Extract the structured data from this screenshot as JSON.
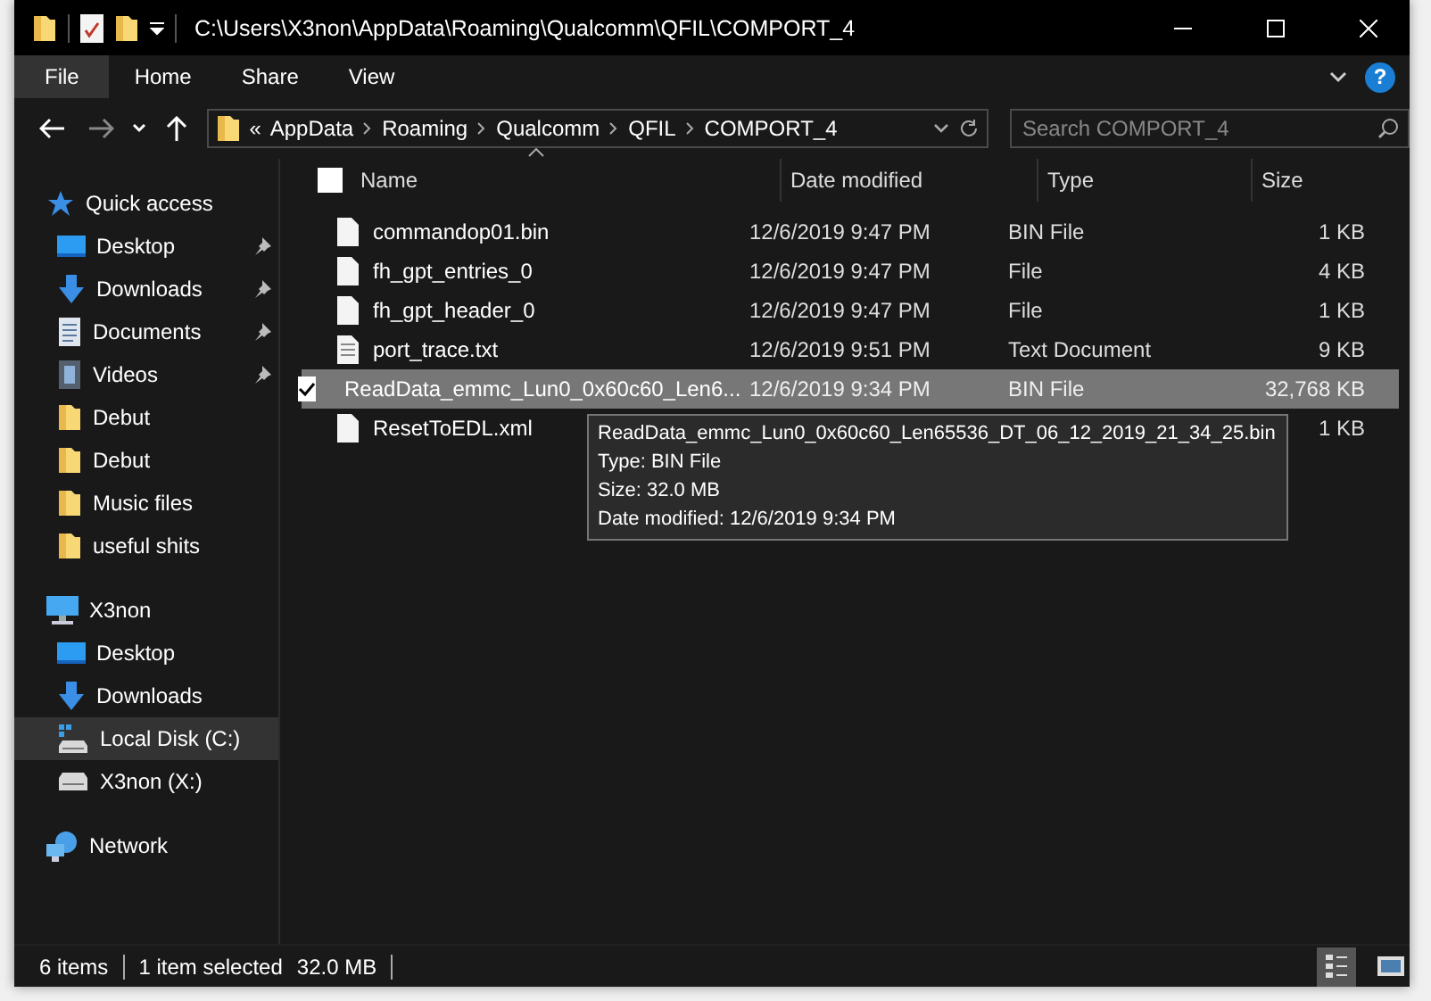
{
  "window": {
    "title": "C:\\Users\\X3non\\AppData\\Roaming\\Qualcomm\\QFIL\\COMPORT_4"
  },
  "ribbon_tabs": [
    {
      "label": "File",
      "selected": true
    },
    {
      "label": "Home",
      "selected": false
    },
    {
      "label": "Share",
      "selected": false
    },
    {
      "label": "View",
      "selected": false
    }
  ],
  "help_button": "?",
  "address": {
    "overflow": "«",
    "crumbs": [
      "AppData",
      "Roaming",
      "Qualcomm",
      "QFIL",
      "COMPORT_4"
    ]
  },
  "search": {
    "placeholder": "Search COMPORT_4"
  },
  "sidebar": {
    "items": [
      {
        "label": "Quick access",
        "kind": "quick",
        "selected": false,
        "children": [
          {
            "label": "Desktop",
            "kind": "desktop",
            "pinned": true,
            "selected": false
          },
          {
            "label": "Downloads",
            "kind": "downloads",
            "pinned": true,
            "selected": false
          },
          {
            "label": "Documents",
            "kind": "documents",
            "pinned": true,
            "selected": false
          },
          {
            "label": "Videos",
            "kind": "videos",
            "pinned": true,
            "selected": false
          },
          {
            "label": "Debut",
            "kind": "folder",
            "pinned": false,
            "selected": false
          },
          {
            "label": "Debut",
            "kind": "folder",
            "pinned": false,
            "selected": false
          },
          {
            "label": "Music files",
            "kind": "folder",
            "pinned": false,
            "selected": false
          },
          {
            "label": "useful shits",
            "kind": "folder",
            "pinned": false,
            "selected": false
          }
        ]
      },
      {
        "label": "X3non",
        "kind": "pc",
        "selected": false,
        "children": [
          {
            "label": "Desktop",
            "kind": "desktop",
            "pinned": false,
            "selected": false
          },
          {
            "label": "Downloads",
            "kind": "downloads",
            "pinned": false,
            "selected": false
          },
          {
            "label": "Local Disk (C:)",
            "kind": "system-disk",
            "pinned": false,
            "selected": true
          },
          {
            "label": "X3non (X:)",
            "kind": "drive",
            "pinned": false,
            "selected": false
          }
        ]
      },
      {
        "label": "Network",
        "kind": "network",
        "selected": false
      }
    ]
  },
  "table": {
    "select_all": {
      "checked": false
    },
    "columns": [
      "Name",
      "Date modified",
      "Type",
      "Size"
    ],
    "rows": [
      {
        "name": "commandop01.bin",
        "date": "12/6/2019 9:47 PM",
        "type": "BIN File",
        "size": "1 KB",
        "kind": "blank",
        "selected": false
      },
      {
        "name": "fh_gpt_entries_0",
        "date": "12/6/2019 9:47 PM",
        "type": "File",
        "size": "4 KB",
        "kind": "blank",
        "selected": false
      },
      {
        "name": "fh_gpt_header_0",
        "date": "12/6/2019 9:47 PM",
        "type": "File",
        "size": "1 KB",
        "kind": "blank",
        "selected": false
      },
      {
        "name": "port_trace.txt",
        "date": "12/6/2019 9:51 PM",
        "type": "Text Document",
        "size": "9 KB",
        "kind": "text",
        "selected": false
      },
      {
        "name": "ReadData_emmc_Lun0_0x60c60_Len6...",
        "date": "12/6/2019 9:34 PM",
        "type": "BIN File",
        "size": "32,768 KB",
        "kind": "blank",
        "selected": true
      },
      {
        "name": "ResetToEDL.xml",
        "size": "1 KB",
        "kind": "blank",
        "selected": false
      }
    ]
  },
  "tooltip": {
    "lines": [
      "ReadData_emmc_Lun0_0x60c60_Len65536_DT_06_12_2019_21_34_25.bin",
      "Type: BIN File",
      "Size: 32.0 MB",
      "Date modified: 12/6/2019 9:34 PM"
    ]
  },
  "status_bar": {
    "count": "6 items",
    "selection": "1 item selected",
    "size": "32.0 MB"
  },
  "view_buttons": [
    {
      "kind": "details",
      "selected": true
    },
    {
      "kind": "large-icons",
      "selected": false
    }
  ]
}
